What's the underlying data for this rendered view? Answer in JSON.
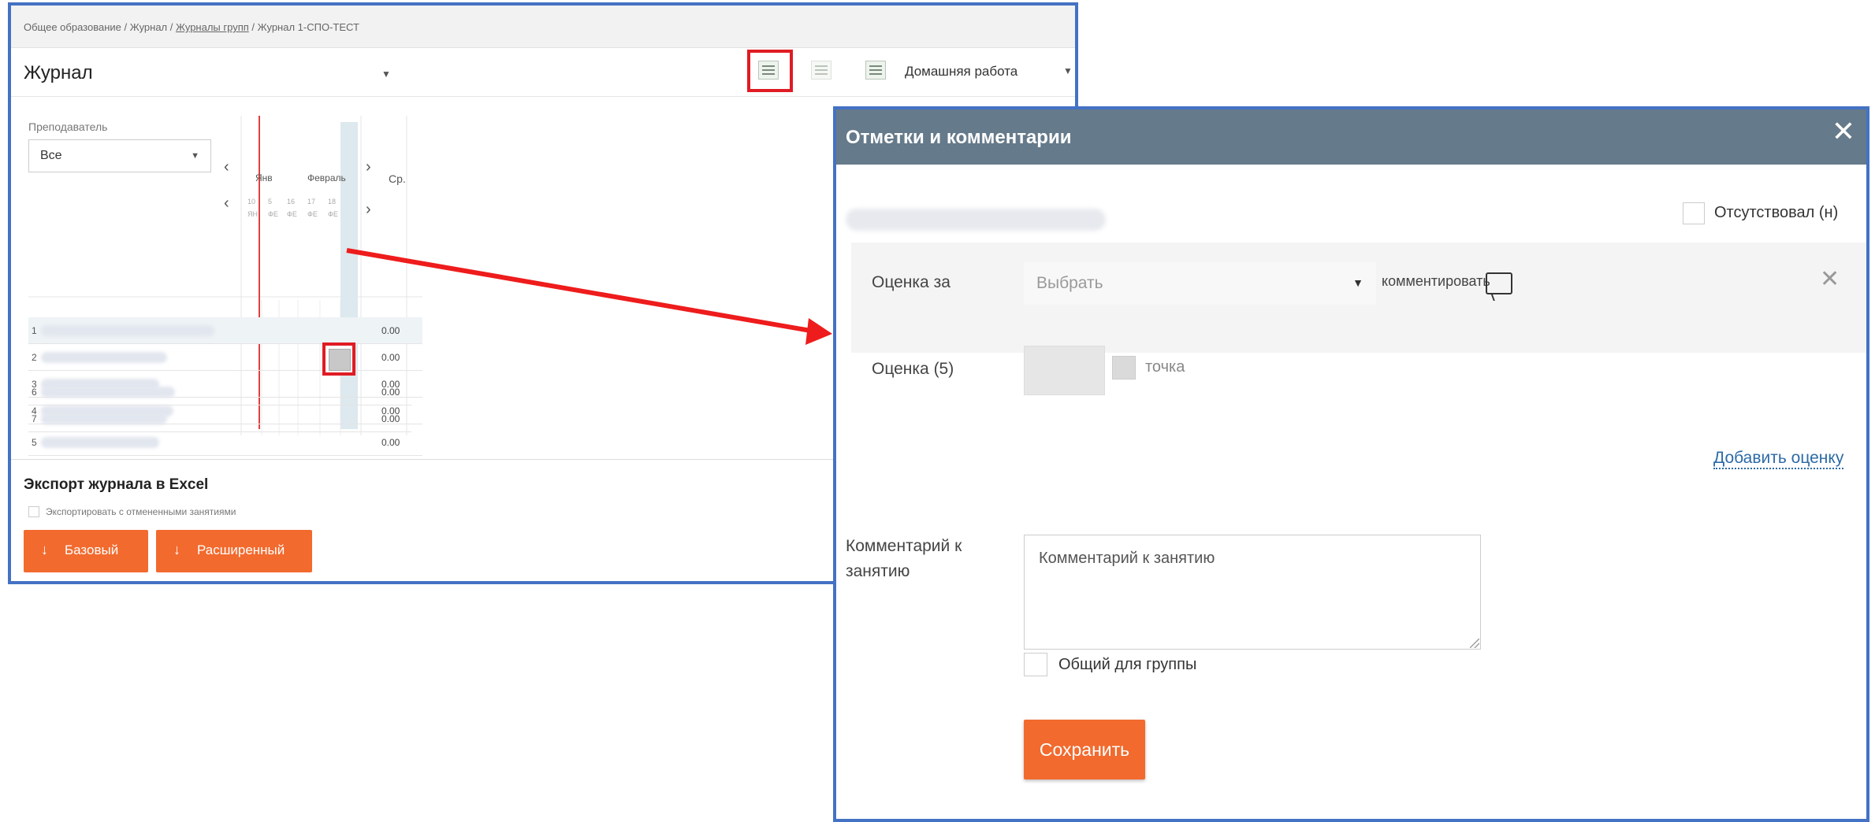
{
  "breadcrumb": {
    "part1": "Общее образование / Журнал / ",
    "part2": "Журналы групп",
    "part3": " / Журнал 1-СПО-ТЕСТ"
  },
  "journal": {
    "title": "Журнал",
    "homework_label": "Домашняя работа",
    "teacher_label": "Преподаватель",
    "teacher_value": "Все",
    "months": [
      "Янв",
      "Февраль"
    ],
    "days": [
      {
        "d": "10",
        "m": "ЯН"
      },
      {
        "d": "5",
        "m": "ФЕ"
      },
      {
        "d": "16",
        "m": "ФЕ"
      },
      {
        "d": "17",
        "m": "ФЕ"
      },
      {
        "d": "18",
        "m": "ФЕ"
      }
    ],
    "avg_header": "Ср.",
    "rows": [
      {
        "num": "1",
        "avg": "0.00"
      },
      {
        "num": "2",
        "avg": "0.00"
      },
      {
        "num": "3",
        "avg": "0.00"
      },
      {
        "num": "4",
        "avg": "0.00"
      },
      {
        "num": "5",
        "avg": "0.00"
      },
      {
        "num": "6",
        "avg": "0.00"
      },
      {
        "num": "7",
        "avg": "0.00"
      }
    ],
    "export_title": "Экспорт журнала в Excel",
    "export_checkbox": "Экспортировать с отмененными занятиями",
    "btn_basic": "Базовый",
    "btn_extended": "Расширенный"
  },
  "dialog": {
    "title": "Отметки и комментарии",
    "absent_label": "Отсутствовал (н)",
    "grade_for_label": "Оценка за",
    "grade_select_placeholder": "Выбрать",
    "comment_link": "комментировать",
    "grade_label": "Оценка (5)",
    "dot_label": "точка",
    "add_grade": "Добавить оценку",
    "lesson_comment_label": "Комментарий к занятию",
    "lesson_comment_placeholder": "Комментарий к занятию",
    "group_common_label": "Общий для группы",
    "save_button": "Сохранить"
  },
  "colors": {
    "accent_orange": "#f26a2e",
    "frame_blue": "#4472c4",
    "highlight_red": "#e01b24",
    "dialog_header": "#657a8a",
    "link_blue": "#2c6aa6"
  }
}
